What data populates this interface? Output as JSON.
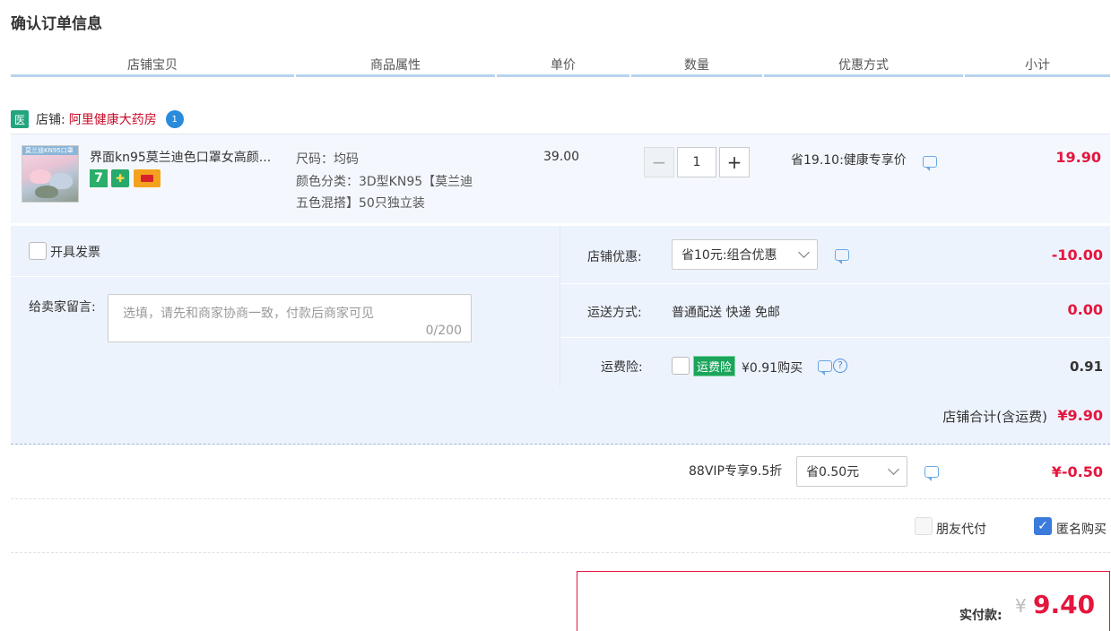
{
  "page": {
    "title": "确认订单信息"
  },
  "columns": [
    "店铺宝贝",
    "商品属性",
    "单价",
    "数量",
    "优惠方式",
    "小计"
  ],
  "shop": {
    "badge": "医",
    "label": "店铺:",
    "name": "阿里健康大药房",
    "chat_badge": "1"
  },
  "item": {
    "title": "界面kn95莫兰迪色口罩女高颜...",
    "thumb_caption": "莫兰迪KN95口罩",
    "badges": [
      "7",
      "shield",
      "card"
    ],
    "attr_size": "尺码：均码",
    "attr_color_line1": "颜色分类：3D型KN95【莫兰迪",
    "attr_color_line2": "五色混搭】50只独立装",
    "unit_price": "39.00",
    "quantity": "1",
    "discount": "省19.10:健康专享价",
    "subtotal": "19.90"
  },
  "options": {
    "invoice_label": "开具发票",
    "memo_label": "给卖家留言:",
    "memo_placeholder": "选填，请先和商家协商一致，付款后商家可见",
    "memo_count": "0/200",
    "shop_discount_label": "店铺优惠:",
    "shop_discount_value": "省10元:组合优惠",
    "shop_discount_amount": "-10.00",
    "shipping_label": "运送方式:",
    "shipping_value": "普通配送 快递 免邮",
    "shipping_amount": "0.00",
    "insurance_label": "运费险:",
    "insurance_badge": "运费险",
    "insurance_text": "¥0.91购买",
    "insurance_amount": "0.91"
  },
  "shop_total": {
    "label": "店铺合计(含运费)",
    "amount": "¥9.90"
  },
  "vip": {
    "label": "88VIP专享9.5折",
    "select_value": "省0.50元",
    "amount": "¥-0.50"
  },
  "extras": {
    "friend_pay": "朋友代付",
    "anonymous": "匿名购买"
  },
  "payment": {
    "label": "实付款:",
    "currency": "¥",
    "amount": "9.40"
  },
  "colors": {
    "accent_red": "#e4163e",
    "header_line": "#b8d4ee",
    "panel_bg": "#edf3fd"
  }
}
